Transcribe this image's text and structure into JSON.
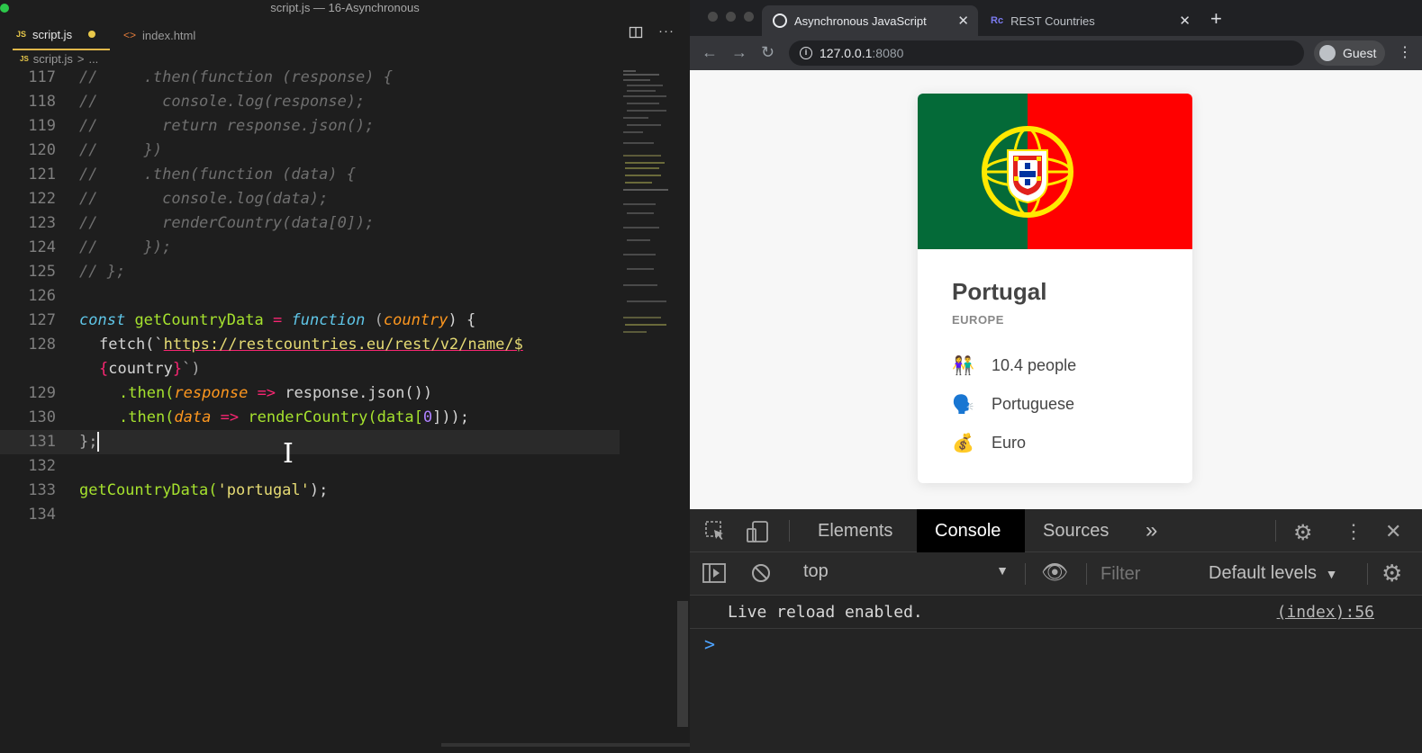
{
  "editor": {
    "window_title": "script.js — 16-Asynchronous",
    "tabs": [
      {
        "icon": "JS",
        "label": "script.js"
      },
      {
        "icon": "<>",
        "label": "index.html"
      }
    ],
    "breadcrumb": {
      "icon": "JS",
      "file": "script.js",
      "sep": ">",
      "more": "..."
    },
    "line_numbers": [
      "117",
      "118",
      "119",
      "120",
      "121",
      "122",
      "123",
      "124",
      "125",
      "126",
      "127",
      "128",
      "",
      "129",
      "130",
      "131",
      "132",
      "133",
      "134"
    ],
    "code": {
      "l117": "//     .then(function (response) {",
      "l118": "//       console.log(response);",
      "l119": "//       return response.json();",
      "l120": "//     })",
      "l121": "//     .then(function (data) {",
      "l122": "//       console.log(data);",
      "l123": "//       renderCountry(data[0]);",
      "l124": "//     });",
      "l125": "// };",
      "l127_const": "const",
      "l127_name": "getCountryData",
      "l127_eq": "=",
      "l127_function": "function",
      "l127_paren_open": "(",
      "l127_param": "country",
      "l127_paren_close": ") {",
      "l128_fetch": "fetch(`",
      "l128_url": "https://restcountries.eu/rest/v2/name/$",
      "l128b_open": "{",
      "l128b_var": "country",
      "l128b_close": "}",
      "l128b_end": "`)",
      "l129_then": ".then(",
      "l129_param": "response",
      "l129_arrow": "=>",
      "l129_rest": "response.json())",
      "l130_then": ".then(",
      "l130_param": "data",
      "l130_arrow": "=>",
      "l130_call": "renderCountry(data[",
      "l130_num": "0",
      "l130_end": "]));",
      "l131": "};",
      "l133_call": "getCountryData(",
      "l133_str": "'portugal'",
      "l133_end": ");"
    }
  },
  "browser": {
    "tabs": [
      {
        "label": "Asynchronous JavaScript",
        "icon": "globe-icon",
        "active": true
      },
      {
        "label": "REST Countries",
        "icon": "Rc",
        "active": false
      }
    ],
    "url_host": "127.0.0.1",
    "url_port": ":8080",
    "profile": "Guest",
    "card": {
      "country": "Portugal",
      "region": "EUROPE",
      "rows": [
        {
          "icon": "👫",
          "text": "10.4 people"
        },
        {
          "icon": "🗣️",
          "text": "Portuguese"
        },
        {
          "icon": "💰",
          "text": "Euro"
        }
      ],
      "flag_colors": {
        "green": "#046a38",
        "red": "#ff0000",
        "yellow": "#ffe900"
      }
    },
    "devtools": {
      "tabs": [
        "Elements",
        "Console",
        "Sources"
      ],
      "active_tab": "Console",
      "more": "»",
      "context": "top",
      "filter_placeholder": "Filter",
      "levels": "Default levels",
      "messages": [
        {
          "text": "Live reload enabled.",
          "source": "(index):56"
        }
      ],
      "prompt": ">"
    }
  }
}
